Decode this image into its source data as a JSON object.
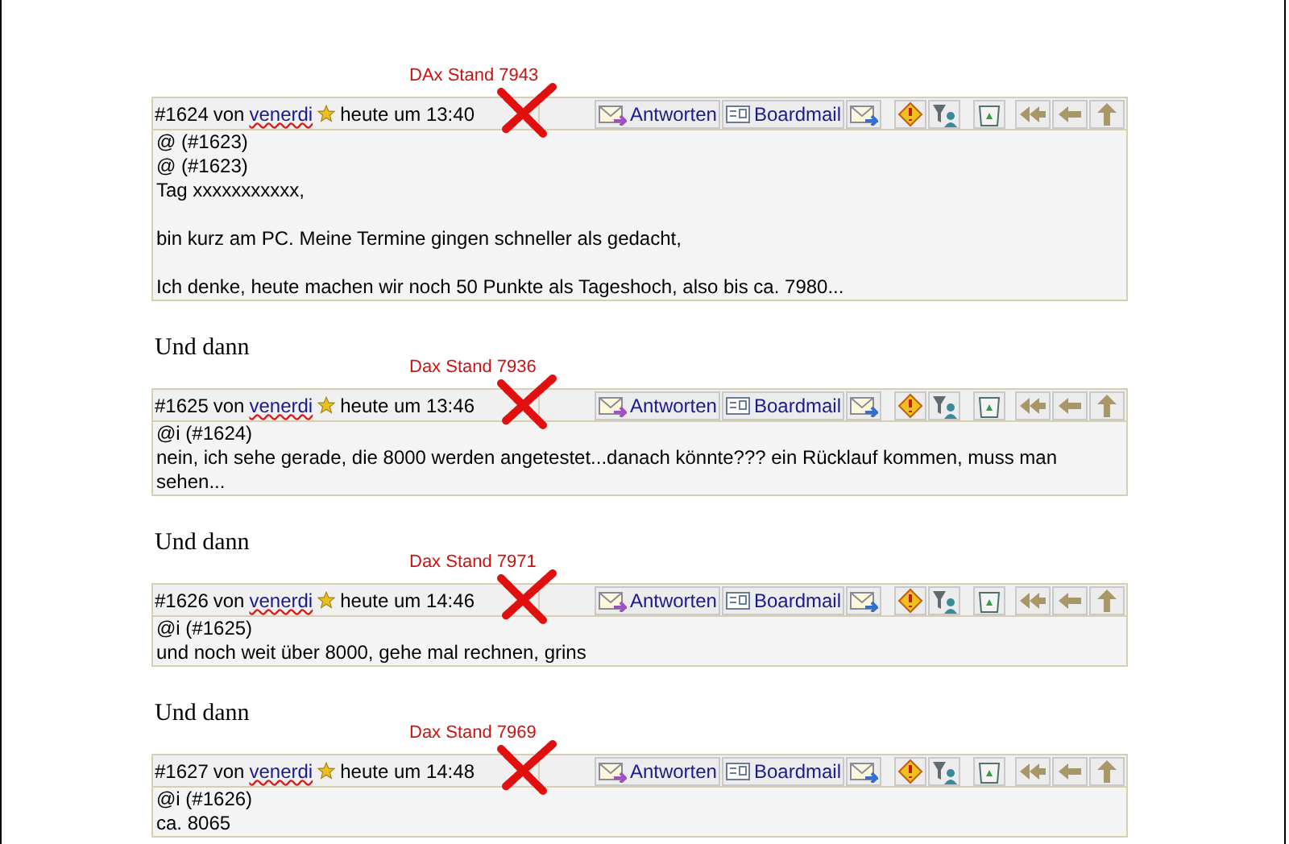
{
  "posts": [
    {
      "annotation": "DAx Stand 7943",
      "number": "#1624",
      "by": "von",
      "author": "venerdi",
      "time": "heute um 13:40",
      "reply": "Antworten",
      "mail": "Boardmail",
      "body": [
        [
          "@ (#1623)",
          "@ (#1623)",
          "Tag xxxxxxxxxxx,"
        ],
        [
          "bin kurz am PC. Meine Termine gingen schneller als gedacht,"
        ],
        [
          "Ich denke, heute machen wir noch 50 Punkte als Tageshoch, also bis ca. 7980..."
        ]
      ]
    },
    {
      "lead": "Und dann",
      "annotation": "Dax Stand 7936",
      "number": "#1625",
      "by": "von",
      "author": "venerdi",
      "time": "heute um 13:46",
      "reply": "Antworten",
      "mail": "Boardmail",
      "body": [
        [
          "@i (#1624)",
          "nein, ich sehe gerade, die 8000 werden angetestet...danach könnte??? ein Rücklauf kommen, muss man sehen..."
        ]
      ]
    },
    {
      "lead": "Und dann",
      "annotation": "Dax Stand 7971",
      "number": "#1626",
      "by": "von",
      "author": "venerdi",
      "time": "heute um 14:46",
      "reply": "Antworten",
      "mail": "Boardmail",
      "body": [
        [
          "@i (#1625)",
          "und noch weit über 8000, gehe mal rechnen, grins"
        ]
      ]
    },
    {
      "lead": "Und dann",
      "annotation": "Dax Stand 7969",
      "number": "#1627",
      "by": "von",
      "author": "venerdi",
      "time": "heute um 14:48",
      "reply": "Antworten",
      "mail": "Boardmail",
      "body": [
        [
          "@i (#1626)",
          "ca. 8065"
        ]
      ]
    }
  ]
}
